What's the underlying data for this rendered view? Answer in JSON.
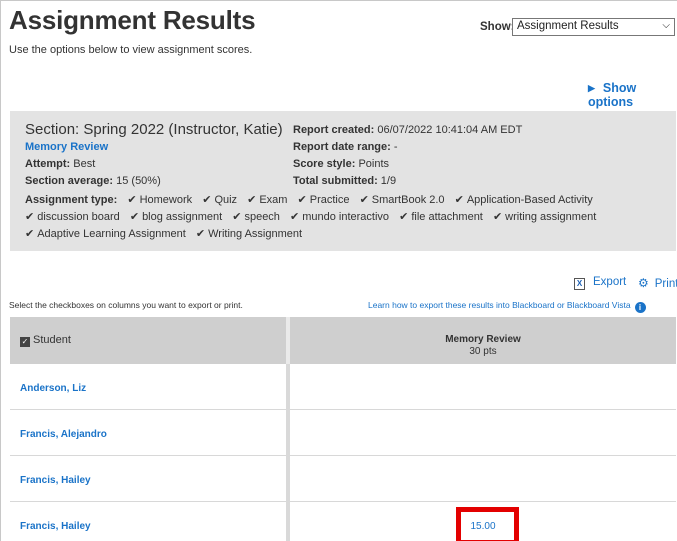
{
  "header": {
    "title": "Assignment Results",
    "subtitle": "Use the options below to view assignment scores.",
    "show_label": "Show:",
    "show_value": "Assignment Results",
    "show_options": "Show options"
  },
  "section": {
    "title": "Section: Spring 2022 (Instructor, Katie)",
    "assignment_link": "Memory Review",
    "attempt_label": "Attempt:",
    "attempt_value": "Best",
    "average_label": "Section average:",
    "average_value": "15 (50%)",
    "report_created_label": "Report created:",
    "report_created_value": "06/07/2022 10:41:04 AM EDT",
    "date_range_label": "Report date range:",
    "date_range_value": "-",
    "score_style_label": "Score style:",
    "score_style_value": "Points",
    "total_submitted_label": "Total submitted:",
    "total_submitted_value": "1/9",
    "assignment_type_label": "Assignment type:",
    "assignment_types": [
      "Homework",
      "Quiz",
      "Exam",
      "Practice",
      "SmartBook 2.0",
      "Application-Based Activity",
      "discussion board",
      "blog assignment",
      "speech",
      "mundo interactivo",
      "file attachment",
      "writing assignment",
      "Adaptive Learning Assignment",
      "Writing Assignment"
    ]
  },
  "tools": {
    "export": "Export",
    "print": "Print",
    "select_note": "Select the checkboxes on columns you want to export or print.",
    "learn_link": "Learn how to export these results into Blackboard or Blackboard Vista"
  },
  "table": {
    "student_header": "Student",
    "assignment_header": "Memory Review",
    "points": "30 pts",
    "rows": [
      {
        "name": "Anderson, Liz",
        "score": ""
      },
      {
        "name": "Francis, Alejandro",
        "score": ""
      },
      {
        "name": "Francis, Hailey",
        "score": ""
      },
      {
        "name": "Francis, Hailey",
        "score": "15.00"
      }
    ]
  },
  "colors": {
    "link": "#1a73c8",
    "panel": "#e3e3e3",
    "header_row": "#cfcfcf",
    "highlight": "#e30000"
  },
  "icons": [
    "chevron-down-icon",
    "triangle-right-icon",
    "checkmark-icon",
    "export-icon",
    "gear-icon",
    "info-icon",
    "checkbox-icon"
  ]
}
